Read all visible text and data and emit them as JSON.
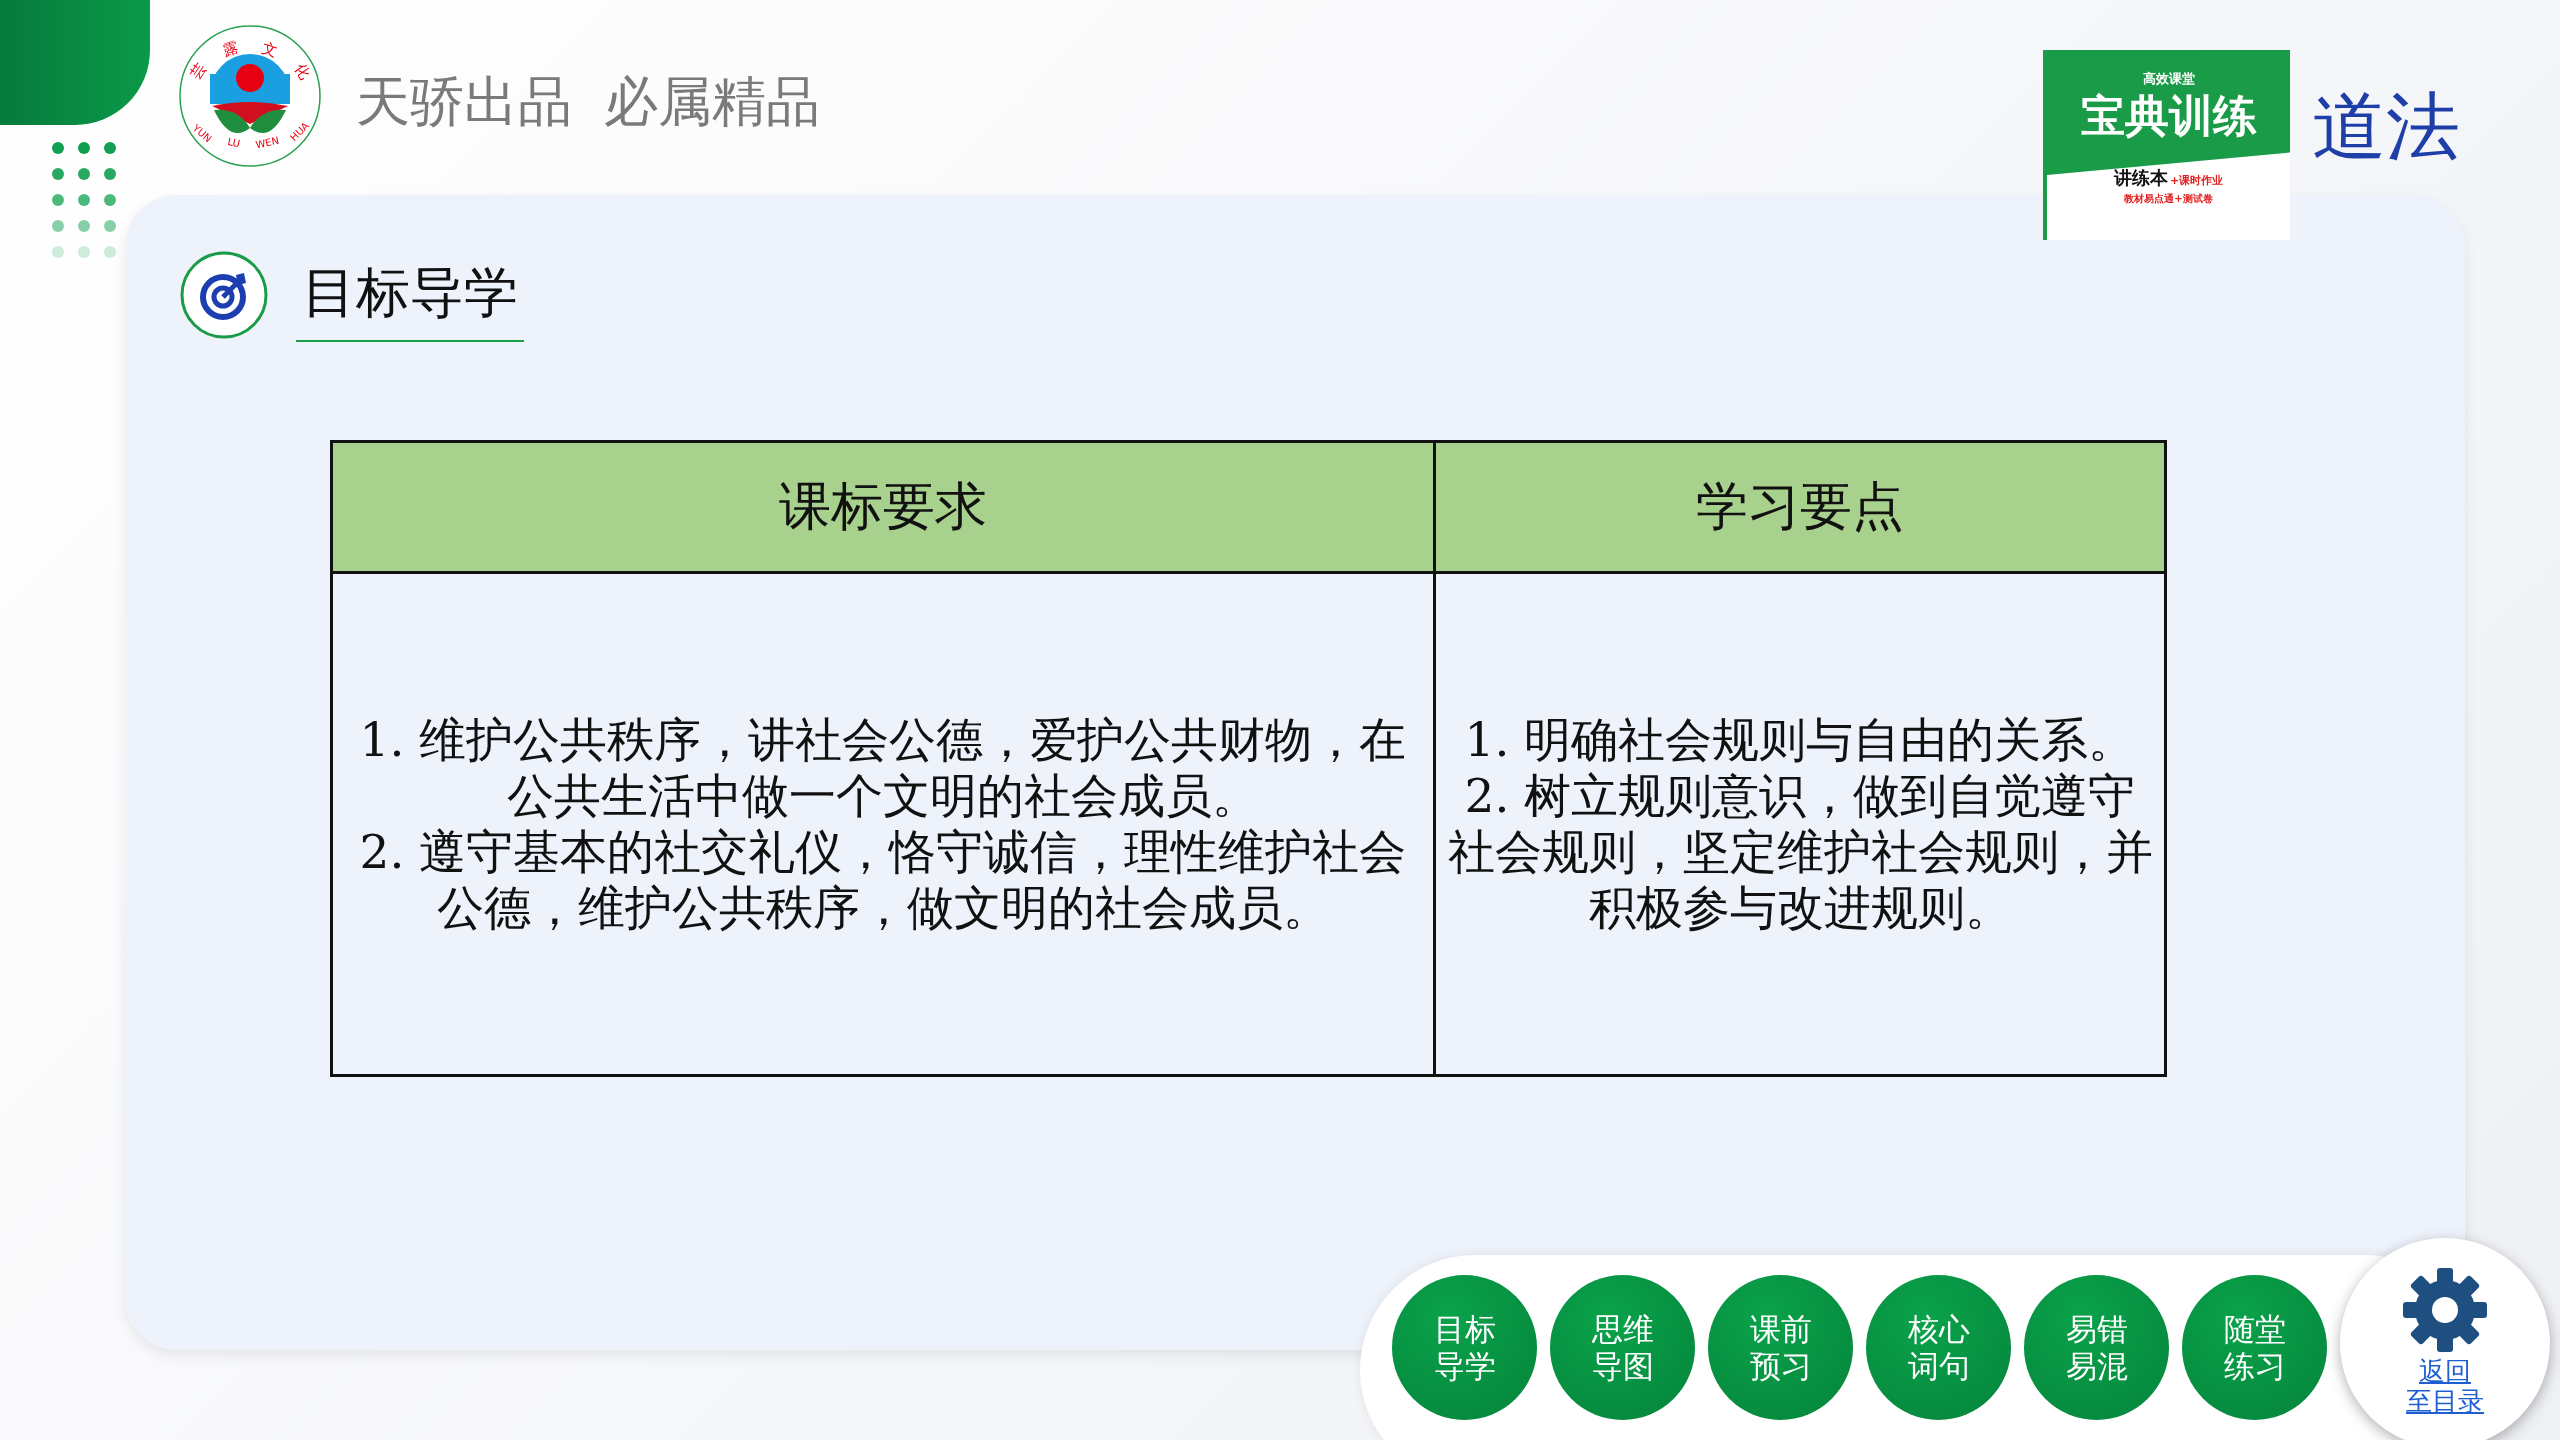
{
  "header": {
    "logo": {
      "top_text": [
        "芸",
        "露",
        "文",
        "化"
      ],
      "bottom_text": [
        "YUN",
        "LU",
        "WEN",
        "HUA"
      ]
    },
    "taglines": [
      "天骄出品",
      "必属精品"
    ],
    "book": {
      "series": "高效课堂",
      "title": "宝典训练",
      "edition": "讲练本",
      "extra": "+课时作业",
      "extra2": "教材易点通+测试卷"
    },
    "subject": "道法"
  },
  "section": {
    "title": "目标导学"
  },
  "table": {
    "columns": [
      "课标要求",
      "学习要点"
    ],
    "cells": [
      [
        "1. 维护公共秩序，讲社会公德，爱护公共财物，在公共生活中做一个文明的社会成员。",
        "2. 遵守基本的社交礼仪，恪守诚信，理性维护社会公德，维护公共秩序，做文明的社会成员。"
      ],
      [
        "1. 明确社会规则与自由的关系。",
        "2. 树立规则意识，做到自觉遵守社会规则，坚定维护社会规则，并积极参与改进规则。"
      ]
    ]
  },
  "nav": [
    {
      "lines": [
        "目标",
        "导学"
      ]
    },
    {
      "lines": [
        "思维",
        "导图"
      ]
    },
    {
      "lines": [
        "课前",
        "预习"
      ]
    },
    {
      "lines": [
        "核心",
        "词句"
      ]
    },
    {
      "lines": [
        "易错",
        "易混"
      ]
    },
    {
      "lines": [
        "随堂",
        "练习"
      ]
    }
  ],
  "back_link": {
    "lines": [
      "返回",
      "至目录"
    ]
  }
}
